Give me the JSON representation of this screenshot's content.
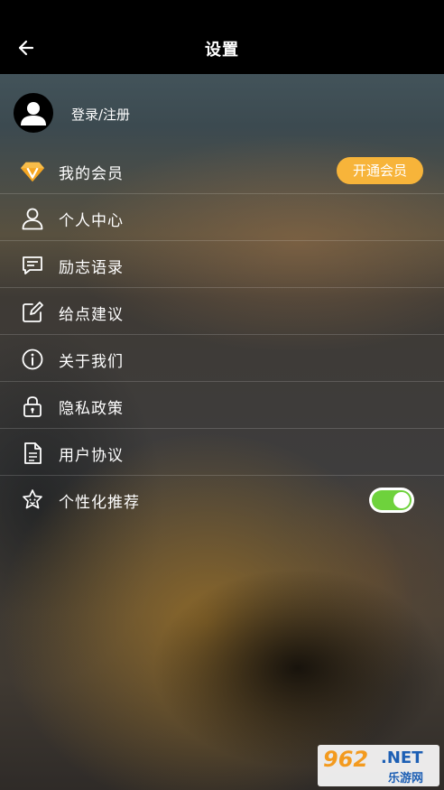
{
  "header": {
    "title": "设置",
    "back_icon": "arrow-left-icon"
  },
  "login": {
    "label": "登录/注册",
    "avatar_icon": "user-avatar-icon"
  },
  "menu": [
    {
      "label": "我的会员",
      "icon": "diamond-v-icon",
      "action_label": "开通会员"
    },
    {
      "label": "个人中心",
      "icon": "person-icon"
    },
    {
      "label": "励志语录",
      "icon": "message-icon"
    },
    {
      "label": "给点建议",
      "icon": "edit-icon"
    },
    {
      "label": "关于我们",
      "icon": "info-icon"
    },
    {
      "label": "隐私政策",
      "icon": "lock-icon"
    },
    {
      "label": "用户协议",
      "icon": "document-icon"
    },
    {
      "label": "个性化推荐",
      "icon": "star-face-icon",
      "toggle_on": true
    }
  ],
  "colors": {
    "vip_button": "#f7b43a",
    "toggle_on": "#6ed23c",
    "header_bg": "#000000"
  },
  "watermark": {
    "number": "962",
    "domain": ".NET",
    "site_name": "乐游网"
  }
}
